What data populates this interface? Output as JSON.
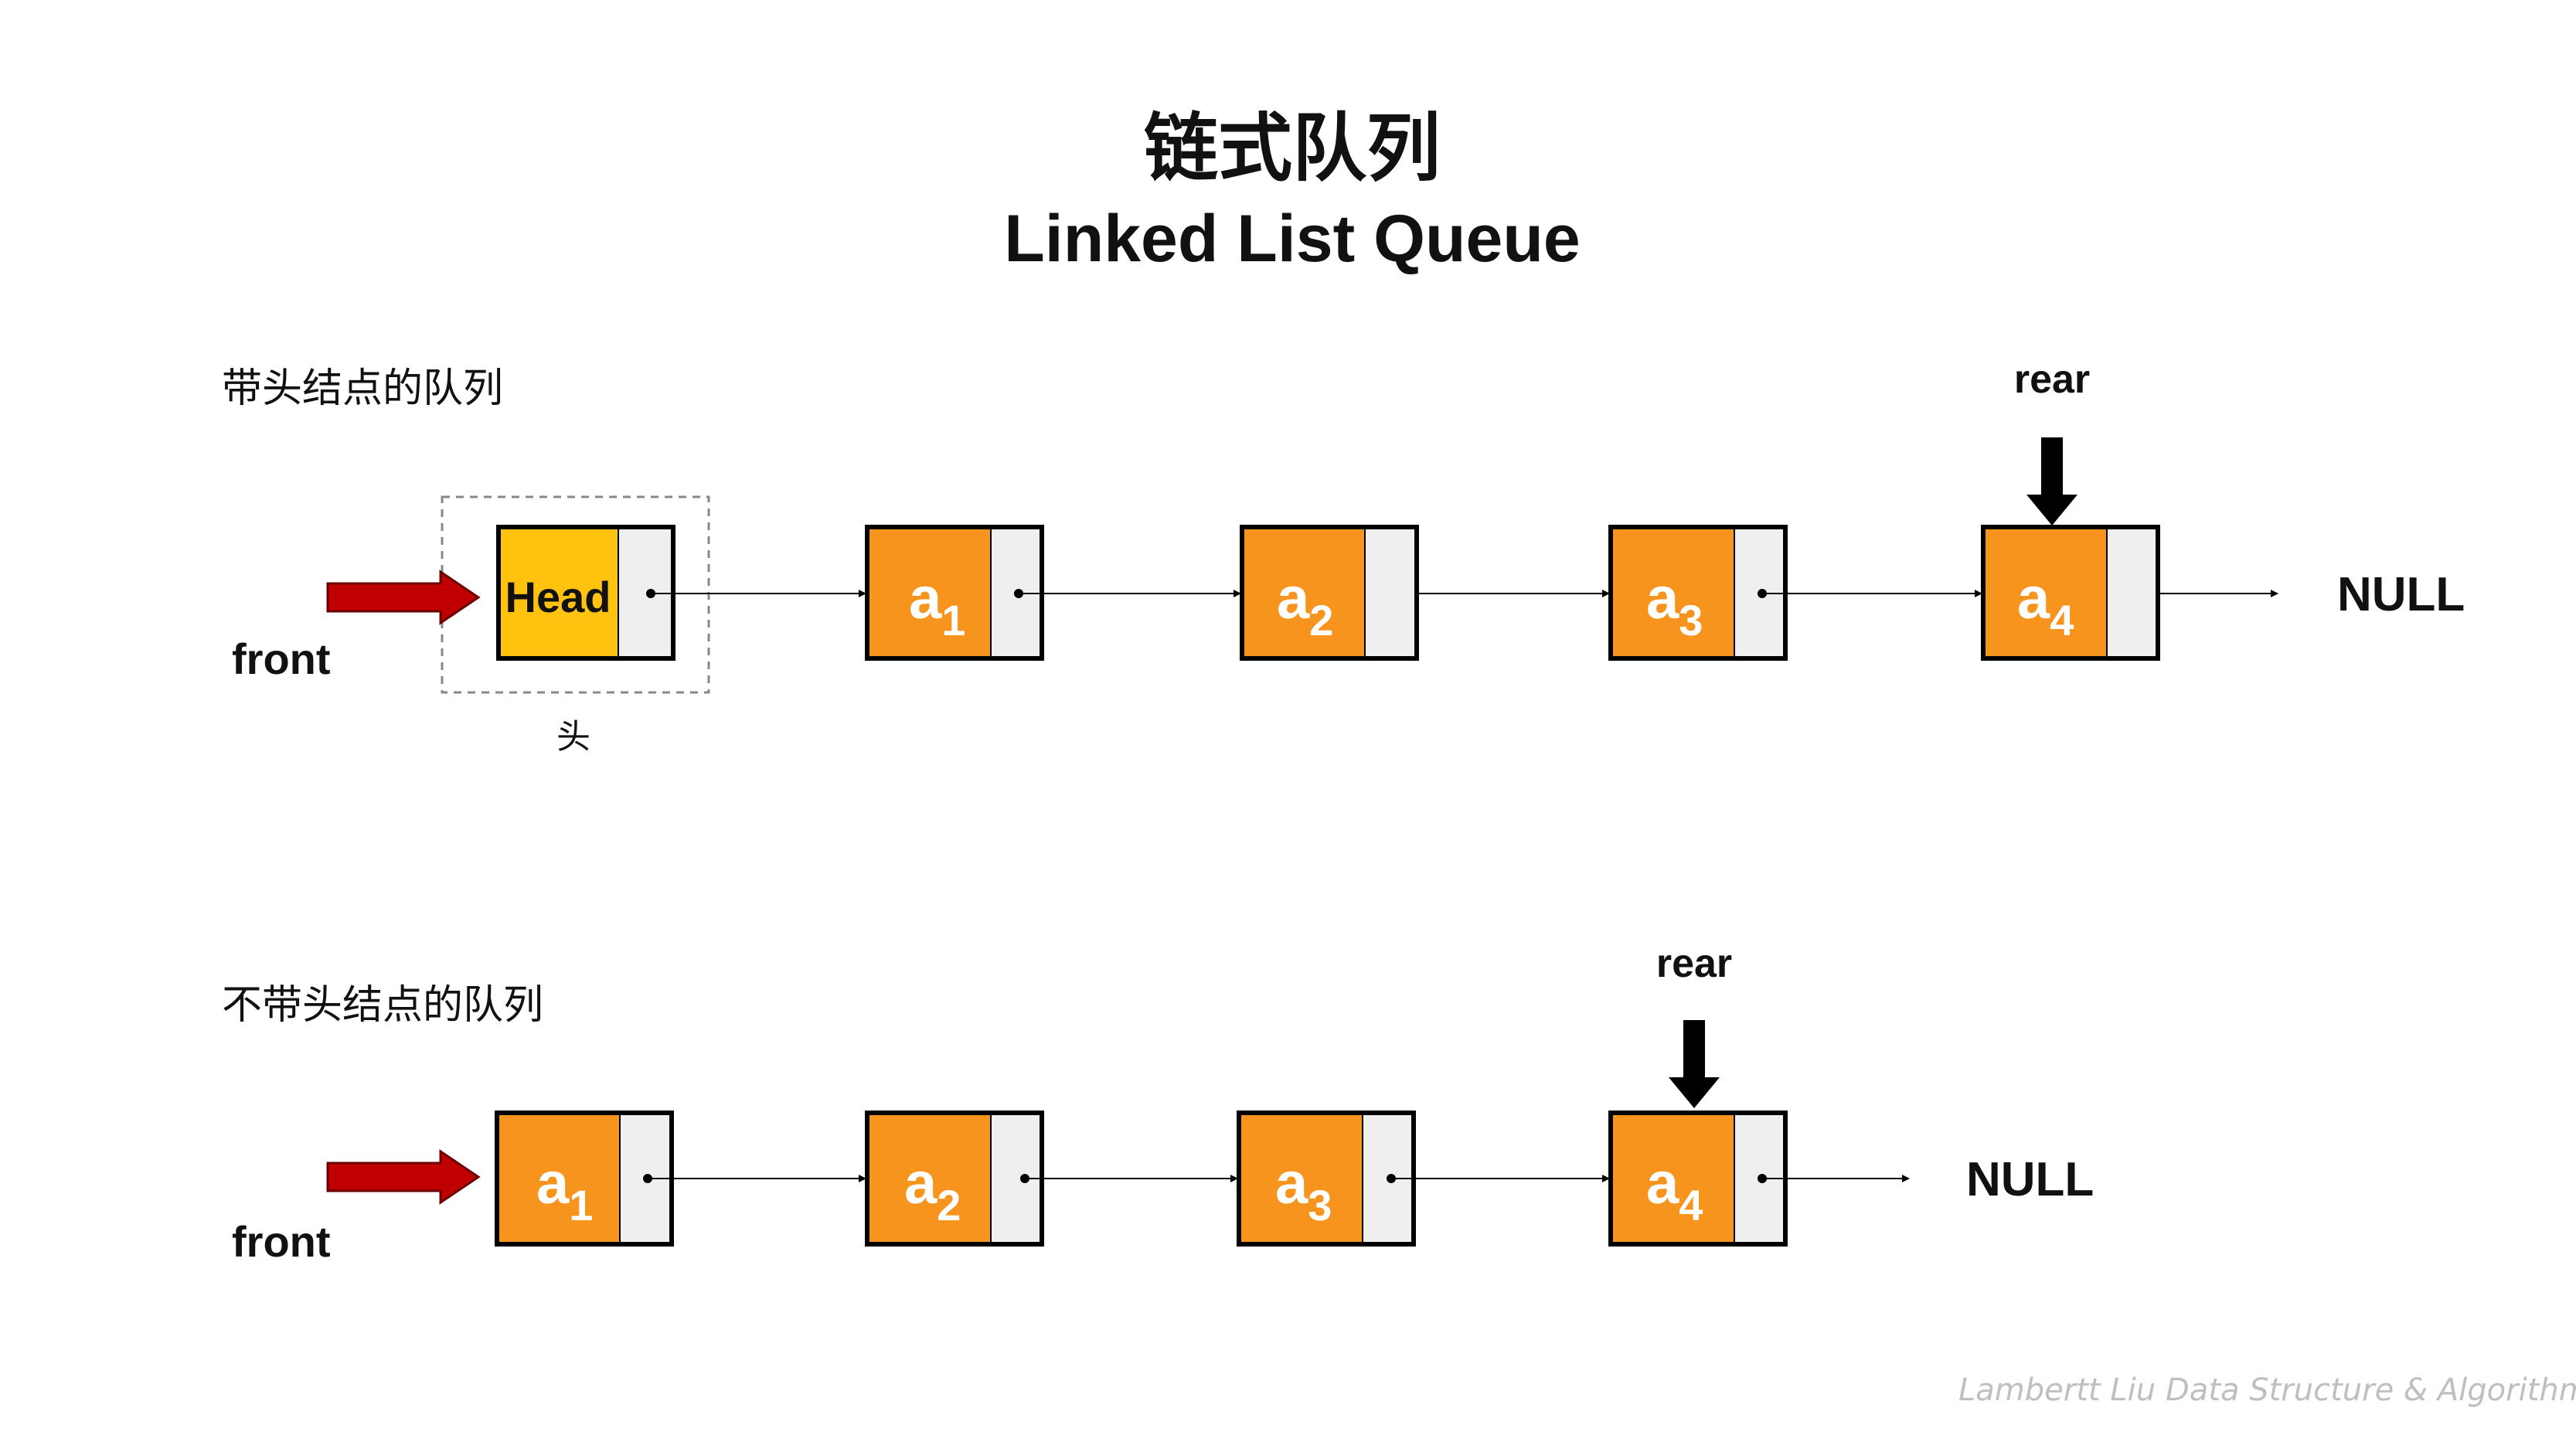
{
  "title": {
    "zh": "链式队列",
    "en": "Linked List Queue"
  },
  "sections": [
    {
      "label": "带头结点的队列",
      "front_label": "front",
      "rear_label": "rear",
      "null_label": "NULL",
      "head_caption": "头",
      "head_node": {
        "label": "Head"
      },
      "nodes": [
        {
          "base": "a",
          "sub": "1"
        },
        {
          "base": "a",
          "sub": "2"
        },
        {
          "base": "a",
          "sub": "3"
        },
        {
          "base": "a",
          "sub": "4"
        }
      ],
      "rear_points_to": "a4"
    },
    {
      "label": "不带头结点的队列",
      "front_label": "front",
      "rear_label": "rear",
      "null_label": "NULL",
      "nodes": [
        {
          "base": "a",
          "sub": "1"
        },
        {
          "base": "a",
          "sub": "2"
        },
        {
          "base": "a",
          "sub": "3"
        },
        {
          "base": "a",
          "sub": "4"
        }
      ],
      "rear_points_to": "a4"
    }
  ],
  "footer": {
    "author": "Lambertt Liu",
    "subject": "Data Structure & Algorithm"
  },
  "colors": {
    "node_fill": "#F7941D",
    "head_fill": "#FFC20E",
    "pointer_cell": "#EFEFEF",
    "front_arrow": "#C00000",
    "rear_arrow": "#000000",
    "text_dark": "#111111",
    "node_text": "#FFFFFF",
    "footer_text": "#BFBFBF",
    "dashed_box": "#888888"
  }
}
